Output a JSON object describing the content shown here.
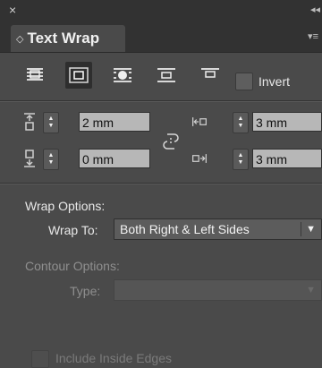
{
  "window": {
    "close_glyph": "×",
    "collapse_glyph": "◂◂",
    "menu_glyph": "▾≡"
  },
  "tab": {
    "updown_glyph": "◇",
    "title": "Text Wrap"
  },
  "wrap_types": {
    "buttons": [
      {
        "name": "no-text-wrap",
        "selected": false
      },
      {
        "name": "wrap-around-bounding-box",
        "selected": true
      },
      {
        "name": "wrap-around-object-shape",
        "selected": false
      },
      {
        "name": "jump-object",
        "selected": false
      },
      {
        "name": "jump-to-next-column",
        "selected": false
      }
    ],
    "invert_label": "Invert",
    "invert_checked": false
  },
  "offsets": {
    "top": "2 mm",
    "bottom": "0 mm",
    "left": "3 mm",
    "right": "3 mm"
  },
  "wrap_options": {
    "heading": "Wrap Options:",
    "wrap_to_label": "Wrap To:",
    "wrap_to_value": "Both Right & Left Sides"
  },
  "contour_options": {
    "heading": "Contour Options:",
    "type_label": "Type:",
    "type_value": ""
  },
  "include_inside_edges": {
    "label": "Include Inside Edges",
    "checked": false
  },
  "colors": {
    "panel_bg": "#4a4a4a",
    "titlebar_bg": "#323232",
    "field_bg": "#b7b7b7"
  }
}
